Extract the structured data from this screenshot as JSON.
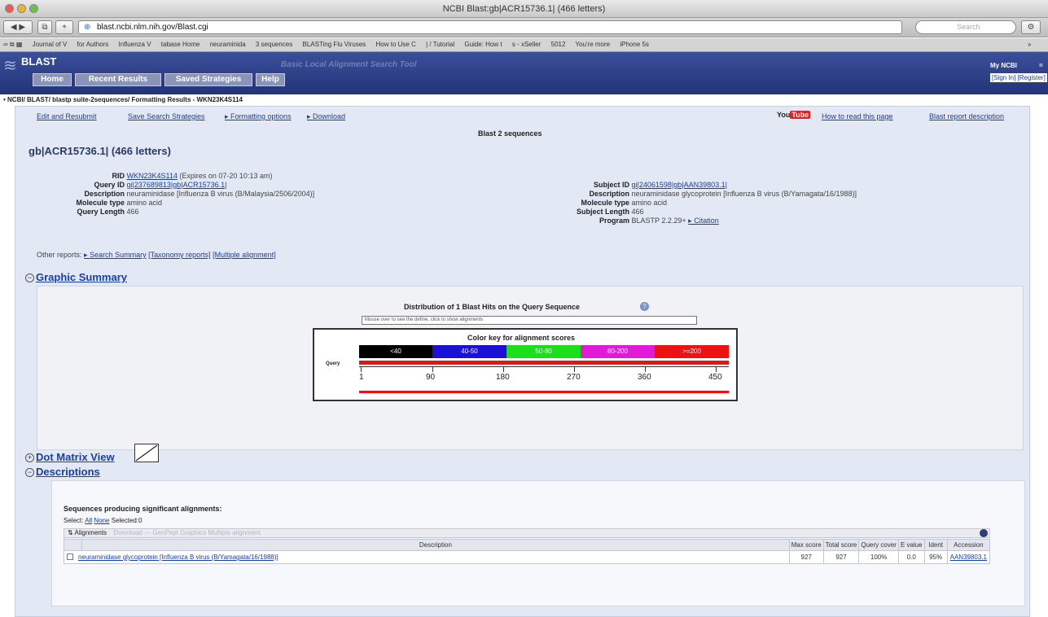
{
  "window": {
    "title": "NCBI Blast:gb|ACR15736.1| (466 letters)"
  },
  "browser": {
    "url": "blast.ncbi.nlm.nih.gov/Blast.cgi",
    "search_placeholder": "Search",
    "bookmarks": [
      "Journal of V",
      "for Authors",
      "Influenza V",
      "tabase Home",
      "neuraminida",
      "3 sequences",
      "BLASTing Flu Viruses",
      "How to Use C",
      "| / Tutorial",
      "Guide: How t",
      "s - xSeller",
      "5012",
      "You're more",
      "iPhone 5s"
    ],
    "bookmarks_more": "»"
  },
  "blast_header": {
    "logo": "BLAST",
    "subtitle": "Basic Local Alignment Search Tool",
    "nav": [
      "Home",
      "Recent Results",
      "Saved Strategies",
      "Help"
    ],
    "my_ncbi": "My NCBI",
    "sign_in": "[Sign In] [Register]"
  },
  "breadcrumb": "• NCBI/ BLAST/ blastp suite-2sequences/ Formatting Results - WKN23K4S114",
  "toplinks": {
    "edit": "Edit and Resubmit",
    "save": "Save Search Strategies",
    "formatting": "▸ Formatting options",
    "download": "▸ Download",
    "youtube": "You",
    "tube": "Tube",
    "how_to_read": "How to read this page",
    "report_desc": "Blast report description"
  },
  "blast_title": "Blast 2 sequences",
  "query_heading": "gb|ACR15736.1| (466 letters)",
  "query_info": [
    {
      "key": "RID",
      "value": "WKN23K4S114",
      "extra": " (Expires on 07-20 10:13 am)",
      "link": true
    },
    {
      "key": "Query ID",
      "value": "gi|237689813|gb|ACR15736.1|",
      "link": true
    },
    {
      "key": "Description",
      "value": "neuraminidase [Influenza B virus (B/Malaysia/2506/2004)]"
    },
    {
      "key": "Molecule type",
      "value": "amino acid"
    },
    {
      "key": "Query Length",
      "value": "466"
    }
  ],
  "subject_info": [
    {
      "key": "Subject ID",
      "value": "gi|24061598|gb|AAN39803.1|",
      "link": true
    },
    {
      "key": "Description",
      "value": "neuraminidase glycoprotein [Influenza B virus (B/Yamagata/16/1988)]"
    },
    {
      "key": "Molecule type",
      "value": "amino acid"
    },
    {
      "key": "Subject Length",
      "value": "466"
    },
    {
      "key": "Program",
      "value": "BLASTP 2.2.29+",
      "extra_link": "▸ Citation"
    }
  ],
  "other_reports": {
    "label": "Other reports:",
    "links": [
      "▸ Search Summary",
      "[Taxonomy reports]",
      "[Multiple alignment]"
    ]
  },
  "graphic_summary": {
    "heading": "Graphic Summary",
    "dist_title": "Distribution of 1 Blast Hits on the Query Sequence",
    "mouse_hint": "Mouse over to see the define, click to show alignments",
    "color_key_title": "Color key for alignment scores",
    "query_label": "Query",
    "color_key": [
      {
        "label": "<40",
        "color": "#000000"
      },
      {
        "label": "40-50",
        "color": "#1a10d8"
      },
      {
        "label": "50-80",
        "color": "#1adf1a"
      },
      {
        "label": "80-200",
        "color": "#e01ad8"
      },
      {
        "label": ">=200",
        "color": "#ee1111"
      }
    ],
    "ticks": [
      "1",
      "90",
      "180",
      "270",
      "360",
      "450"
    ],
    "hit_color": "#ee1111"
  },
  "dot_matrix": {
    "heading": "Dot Matrix View"
  },
  "descriptions": {
    "heading": "Descriptions",
    "seq_heading": "Sequences producing significant alignments:",
    "select_label": "Select:",
    "select_all": "All",
    "select_none": "None",
    "selected": "Selected:0",
    "alignments_label": "Alignments",
    "alignments_actions": "Download  —  GenPept  Graphics  Multiple alignment",
    "columns": [
      "Description",
      "Max score",
      "Total score",
      "Query cover",
      "E value",
      "Ident",
      "Accession"
    ],
    "rows": [
      {
        "description": "neuraminidase glycoprotein [Influenza B virus (B/Yamagata/16/1988)]",
        "max_score": "927",
        "total_score": "927",
        "query_cover": "100%",
        "e_value": "0.0",
        "ident": "95%",
        "accession": "AAN39803.1"
      }
    ]
  }
}
